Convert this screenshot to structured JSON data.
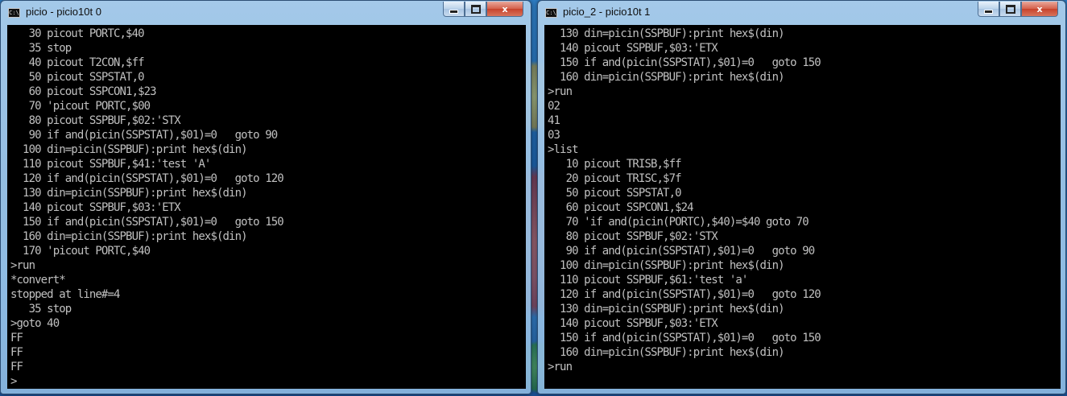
{
  "desktop": {
    "colors": {
      "accent": "#1b5fa6"
    }
  },
  "windows": [
    {
      "title": "picio - picio10t  0",
      "icon": "console-icon",
      "icon_text": "C:\\",
      "controls": {
        "minimize": "minimize-icon",
        "maximize": "maximize-icon",
        "close": "close-icon",
        "close_label": "x"
      },
      "lines": [
        "   30 picout PORTC,$40",
        "   35 stop",
        "   40 picout T2CON,$ff",
        "   50 picout SSPSTAT,0",
        "   60 picout SSPCON1,$23",
        "   70 'picout PORTC,$00",
        "   80 picout SSPBUF,$02:'STX",
        "   90 if and(picin(SSPSTAT),$01)=0   goto 90",
        "  100 din=picin(SSPBUF):print hex$(din)",
        "  110 picout SSPBUF,$41:'test 'A'",
        "  120 if and(picin(SSPSTAT),$01)=0   goto 120",
        "  130 din=picin(SSPBUF):print hex$(din)",
        "  140 picout SSPBUF,$03:'ETX",
        "  150 if and(picin(SSPSTAT),$01)=0   goto 150",
        "  160 din=picin(SSPBUF):print hex$(din)",
        "  170 'picout PORTC,$40",
        ">run",
        "*convert*",
        "stopped at line#=4",
        "   35 stop",
        ">goto 40",
        "FF",
        "FF",
        "FF",
        ">"
      ]
    },
    {
      "title": "picio_2 - picio10t  1",
      "icon": "console-icon",
      "icon_text": "C:\\",
      "controls": {
        "minimize": "minimize-icon",
        "maximize": "maximize-icon",
        "close": "close-icon",
        "close_label": "x"
      },
      "lines": [
        "  130 din=picin(SSPBUF):print hex$(din)",
        "  140 picout SSPBUF,$03:'ETX",
        "  150 if and(picin(SSPSTAT),$01)=0   goto 150",
        "  160 din=picin(SSPBUF):print hex$(din)",
        ">run",
        "02",
        "41",
        "03",
        ">list",
        "   10 picout TRISB,$ff",
        "   20 picout TRISC,$7f",
        "   50 picout SSPSTAT,0",
        "   60 picout SSPCON1,$24",
        "   70 'if and(picin(PORTC),$40)=$40 goto 70",
        "   80 picout SSPBUF,$02:'STX",
        "   90 if and(picin(SSPSTAT),$01)=0   goto 90",
        "  100 din=picin(SSPBUF):print hex$(din)",
        "  110 picout SSPBUF,$61:'test 'a'",
        "  120 if and(picin(SSPSTAT),$01)=0   goto 120",
        "  130 din=picin(SSPBUF):print hex$(din)",
        "  140 picout SSPBUF,$03:'ETX",
        "  150 if and(picin(SSPSTAT),$01)=0   goto 150",
        "  160 din=picin(SSPBUF):print hex$(din)",
        ">run"
      ]
    }
  ]
}
